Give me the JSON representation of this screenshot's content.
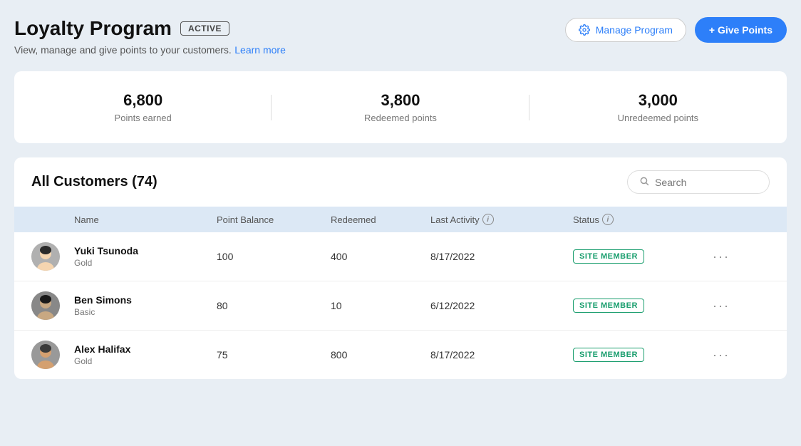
{
  "page": {
    "title": "Loyalty Program",
    "active_badge": "ACTIVE",
    "subtitle": "View, manage and give points to your customers.",
    "learn_more_label": "Learn more"
  },
  "header": {
    "manage_btn_label": "Manage Program",
    "give_points_btn_label": "+ Give Points"
  },
  "stats": {
    "points_earned": "6,800",
    "points_earned_label": "Points earned",
    "redeemed_points": "3,800",
    "redeemed_points_label": "Redeemed points",
    "unredeemed_points": "3,000",
    "unredeemed_points_label": "Unredeemed points"
  },
  "customers_section": {
    "title": "All Customers (74)",
    "search_placeholder": "Search",
    "table_headers": {
      "name": "Name",
      "point_balance": "Point Balance",
      "redeemed": "Redeemed",
      "last_activity": "Last Activity",
      "status": "Status"
    },
    "customers": [
      {
        "id": "yuki",
        "name": "Yuki Tsunoda",
        "tier": "Gold",
        "point_balance": "100",
        "redeemed": "400",
        "last_activity": "8/17/2022",
        "status": "SITE MEMBER"
      },
      {
        "id": "ben",
        "name": "Ben Simons",
        "tier": "Basic",
        "point_balance": "80",
        "redeemed": "10",
        "last_activity": "6/12/2022",
        "status": "SITE MEMBER"
      },
      {
        "id": "alex",
        "name": "Alex Halifax",
        "tier": "Gold",
        "point_balance": "75",
        "redeemed": "800",
        "last_activity": "8/17/2022",
        "status": "SITE MEMBER"
      }
    ]
  }
}
